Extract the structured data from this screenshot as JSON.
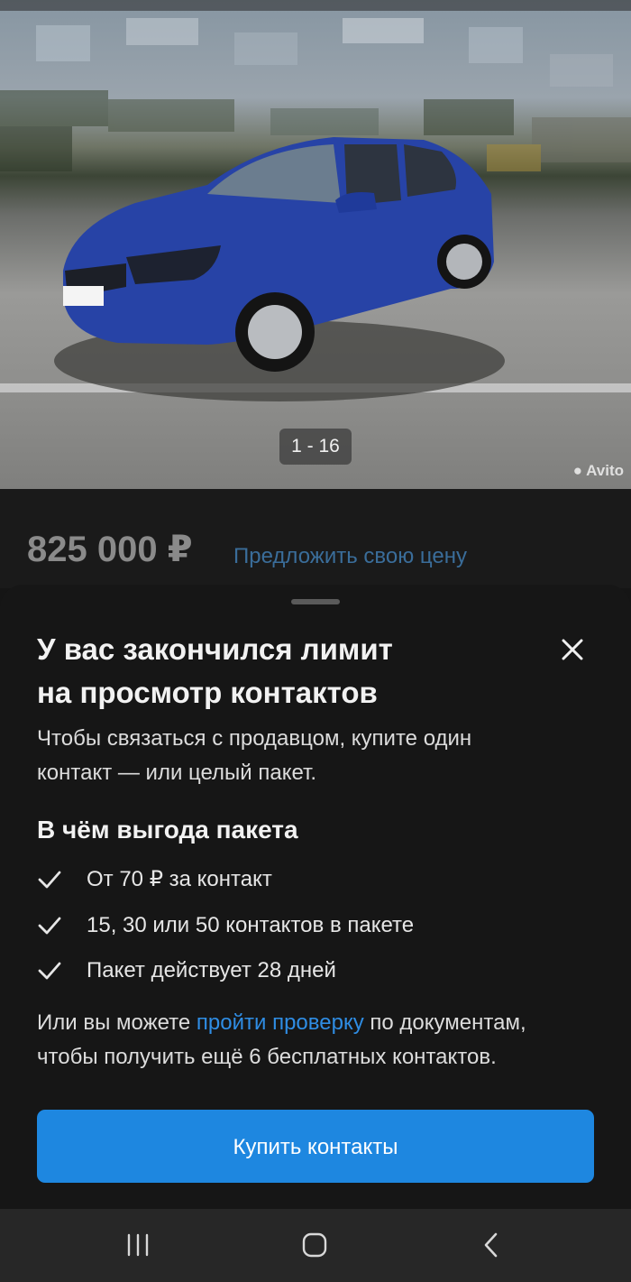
{
  "listing": {
    "photo_counter": "1 - 16",
    "watermark": "Avito",
    "price": "825 000 ₽",
    "offer_link": "Предложить свою цену"
  },
  "sheet": {
    "title_line1": "У вас закончился лимит",
    "title_line2": "на просмотр контактов",
    "subtitle_line1": "Чтобы связаться с продавцом, купите один",
    "subtitle_line2": "контакт — или целый пакет.",
    "benefits_title": "В чём выгода пакета",
    "benefits": [
      "От 70 ₽ за контакт",
      "15, 30 или 50 контактов в пакете",
      "Пакет действует 28 дней"
    ],
    "note_before": "Или вы можете ",
    "note_link": "пройти проверку",
    "note_after_line1": " по документам,",
    "note_line2": "чтобы получить ещё 6 бесплатных контактов.",
    "buy_button": "Купить контакты"
  },
  "icons": {
    "close": "close-icon",
    "check": "check-icon",
    "recents": "recents-icon",
    "home": "home-icon",
    "back": "back-icon"
  },
  "colors": {
    "accent": "#1e87e0",
    "link": "#2f8de4",
    "sheet_bg": "#161616"
  }
}
